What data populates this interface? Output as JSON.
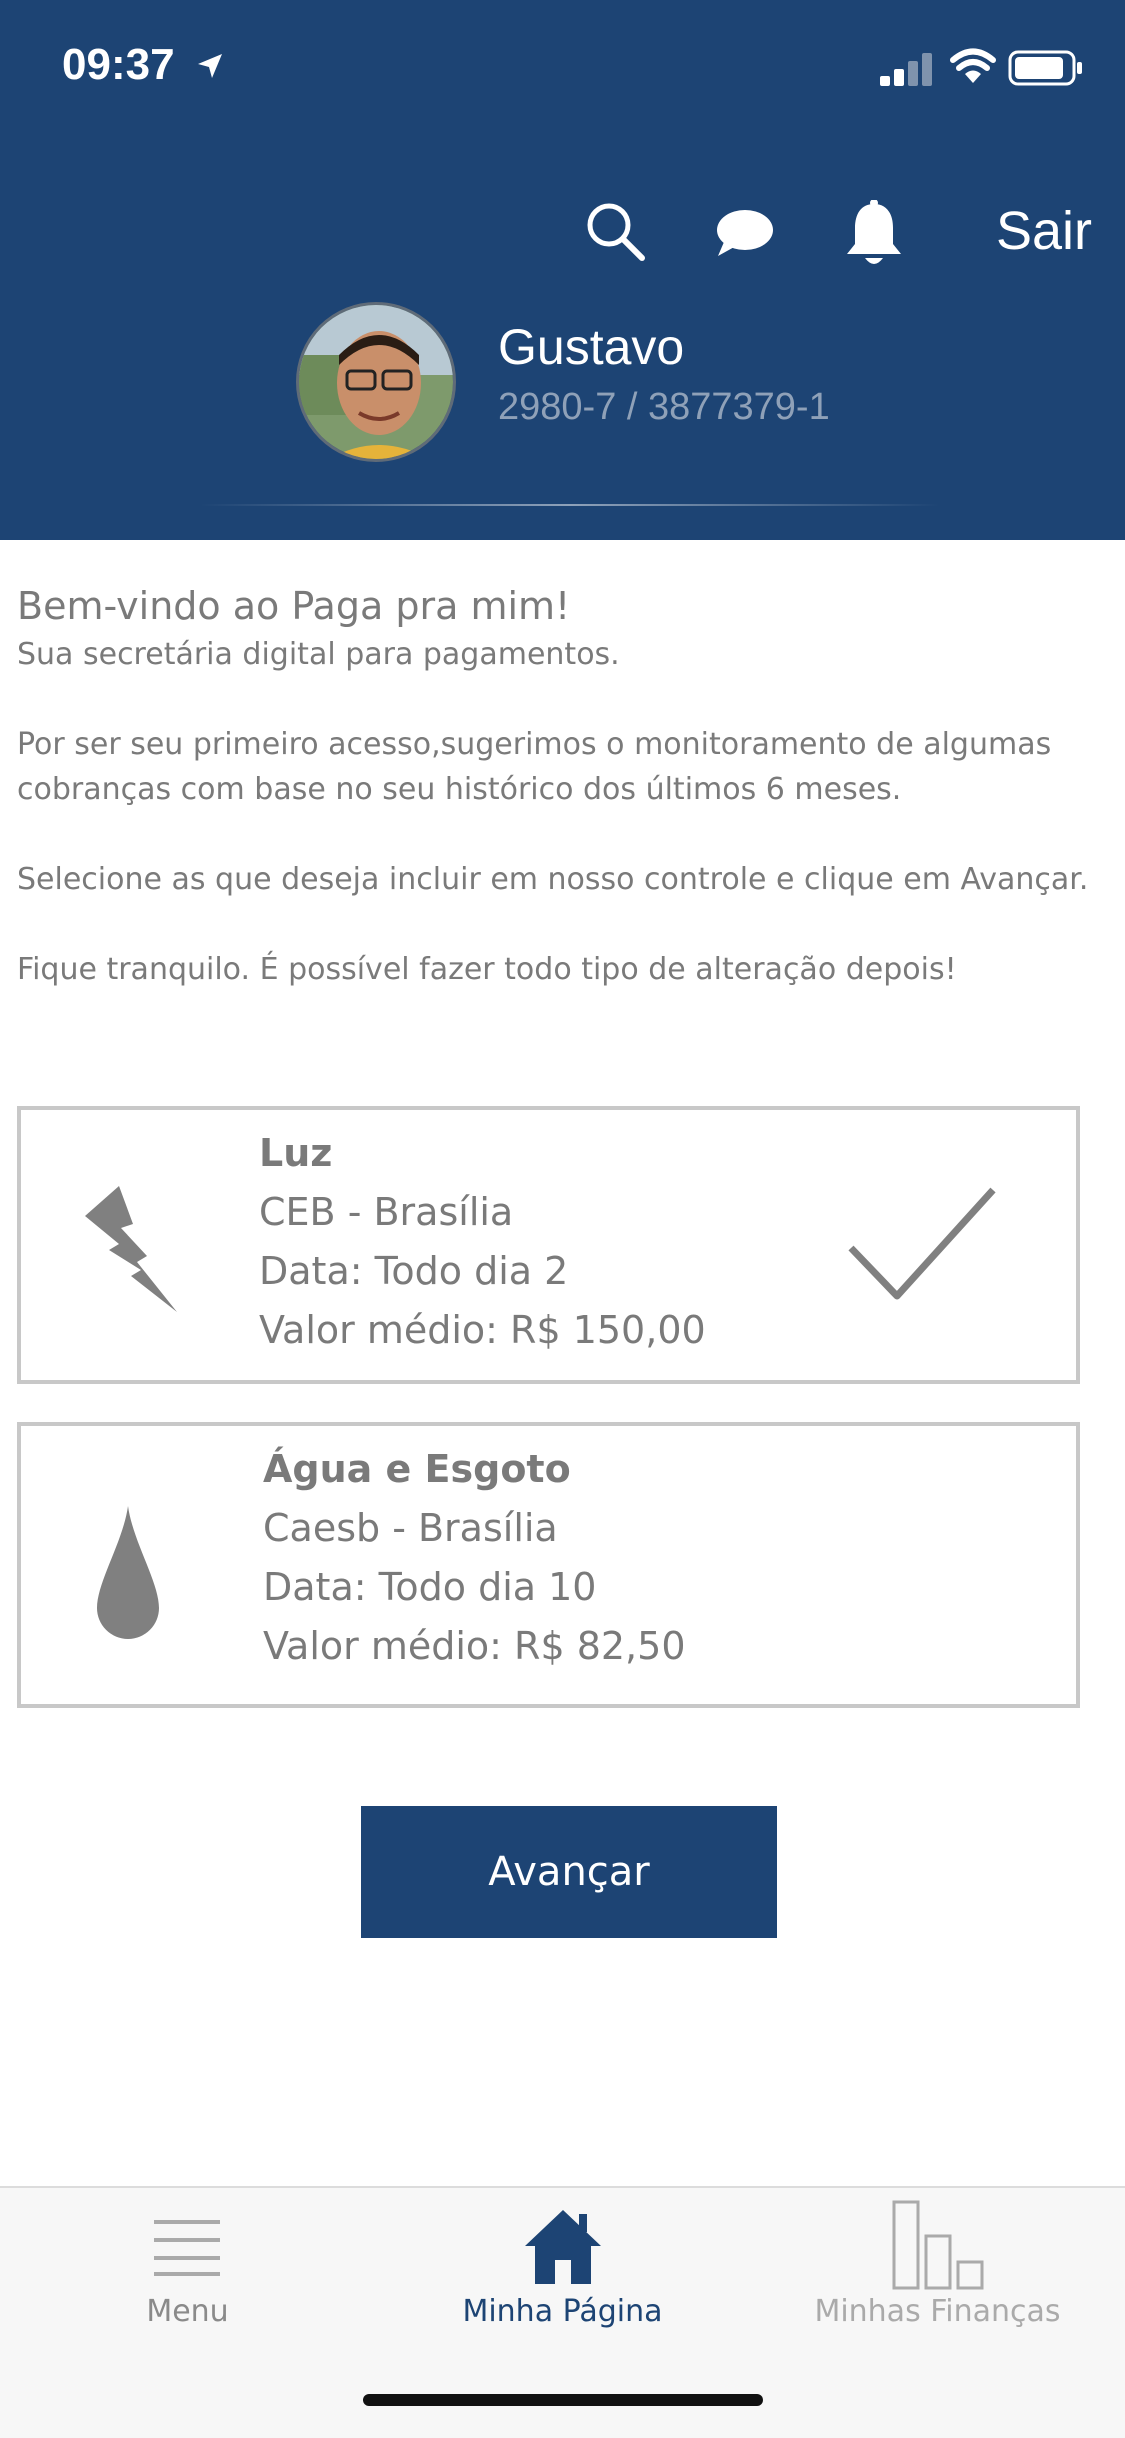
{
  "status_bar": {
    "time": "09:37"
  },
  "header": {
    "search_icon": "search-icon",
    "chat_icon": "chat-icon",
    "bell_icon": "bell-icon",
    "logout_label": "Sair",
    "user_name": "Gustavo",
    "account": "2980-7 / 3877379-1"
  },
  "intro": {
    "welcome": "Bem-vindo ao Paga pra mim!",
    "subtitle": "Sua secretária digital para pagamentos.",
    "para1": "Por ser seu primeiro acesso,sugerimos o monitoramento de algumas cobranças com base no seu histórico dos últimos 6 meses.",
    "para2": "Selecione as que deseja incluir em nosso controle e clique em Avançar.",
    "para3": "Fique tranquilo. É possível fazer todo tipo de alteração depois!"
  },
  "bills": [
    {
      "title": "Luz",
      "provider": "CEB - Brasília",
      "date": "Data: Todo dia 2",
      "value": "Valor médio: R$ 150,00",
      "icon": "lightning-icon",
      "selected": true
    },
    {
      "title": "Água e Esgoto",
      "provider": "Caesb - Brasília",
      "date": "Data: Todo dia 10",
      "value": "Valor médio: R$ 82,50",
      "icon": "water-drop-icon",
      "selected": false
    }
  ],
  "advance_button": "Avançar",
  "tabs": [
    {
      "label": "Menu",
      "icon": "menu-icon",
      "active": false
    },
    {
      "label": "Minha Página",
      "icon": "home-icon",
      "active": true
    },
    {
      "label": "Minhas Finanças",
      "icon": "bar-chart-icon",
      "active": false
    }
  ],
  "colors": {
    "primary": "#1d4474",
    "text_gray": "#7a7a7a",
    "border_gray": "#c8c8c8"
  }
}
